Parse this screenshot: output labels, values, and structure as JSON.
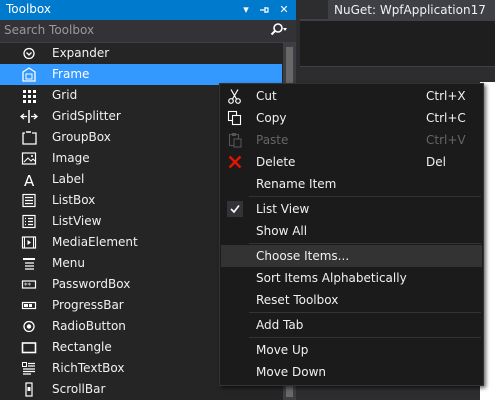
{
  "toolbox": {
    "title": "Toolbox",
    "search_placeholder": "Search Toolbox",
    "items": [
      {
        "label": "Expander",
        "icon": "expander-icon"
      },
      {
        "label": "Frame",
        "icon": "frame-icon",
        "selected": true
      },
      {
        "label": "Grid",
        "icon": "grid-icon"
      },
      {
        "label": "GridSplitter",
        "icon": "gridsplitter-icon"
      },
      {
        "label": "GroupBox",
        "icon": "groupbox-icon"
      },
      {
        "label": "Image",
        "icon": "image-icon"
      },
      {
        "label": "Label",
        "icon": "label-icon"
      },
      {
        "label": "ListBox",
        "icon": "listbox-icon"
      },
      {
        "label": "ListView",
        "icon": "listview-icon"
      },
      {
        "label": "MediaElement",
        "icon": "mediaelement-icon"
      },
      {
        "label": "Menu",
        "icon": "menu-icon"
      },
      {
        "label": "PasswordBox",
        "icon": "passwordbox-icon"
      },
      {
        "label": "ProgressBar",
        "icon": "progressbar-icon"
      },
      {
        "label": "RadioButton",
        "icon": "radiobutton-icon"
      },
      {
        "label": "Rectangle",
        "icon": "rectangle-icon"
      },
      {
        "label": "RichTextBox",
        "icon": "richtextbox-icon"
      },
      {
        "label": "ScrollBar",
        "icon": "scrollbar-icon"
      }
    ]
  },
  "editor": {
    "tab_label": "NuGet: WpfApplication17"
  },
  "context_menu": {
    "items": [
      {
        "label": "Cut",
        "shortcut": "Ctrl+X",
        "icon": "cut-icon"
      },
      {
        "label": "Copy",
        "shortcut": "Ctrl+C",
        "icon": "copy-icon"
      },
      {
        "label": "Paste",
        "shortcut": "Ctrl+V",
        "icon": "paste-icon",
        "disabled": true
      },
      {
        "label": "Delete",
        "shortcut": "Del",
        "icon": "delete-icon"
      },
      {
        "label": "Rename Item",
        "shortcut": ""
      },
      {
        "label": "List View",
        "shortcut": "",
        "icon": "checkmark-icon"
      },
      {
        "label": "Show All",
        "shortcut": ""
      },
      {
        "label": "Choose Items...",
        "shortcut": "",
        "highlighted": true
      },
      {
        "label": "Sort Items Alphabetically",
        "shortcut": ""
      },
      {
        "label": "Reset Toolbox",
        "shortcut": ""
      },
      {
        "label": "Add Tab",
        "shortcut": ""
      },
      {
        "label": "Move Up",
        "shortcut": ""
      },
      {
        "label": "Move Down",
        "shortcut": ""
      }
    ]
  },
  "colors": {
    "accent": "#007acc",
    "selection": "#3399ff",
    "delete_icon": "#e51400"
  }
}
